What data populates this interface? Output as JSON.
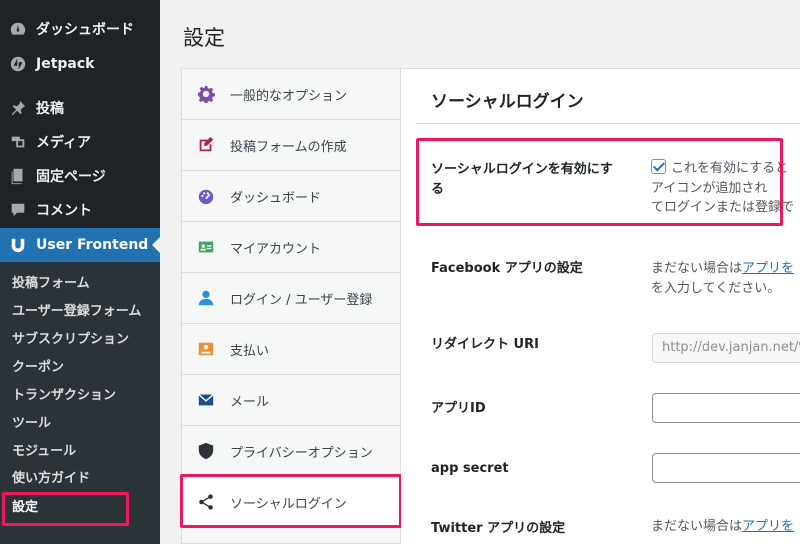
{
  "admin_menu": {
    "items": [
      {
        "label": "ダッシュボード",
        "icon": "dashboard-icon"
      },
      {
        "label": "Jetpack",
        "icon": "jetpack-icon"
      },
      {
        "label": "投稿",
        "icon": "pin-icon"
      },
      {
        "label": "メディア",
        "icon": "media-icon"
      },
      {
        "label": "固定ページ",
        "icon": "page-icon"
      },
      {
        "label": "コメント",
        "icon": "comment-icon"
      },
      {
        "label": "User Frontend",
        "icon": "user-frontend-icon"
      }
    ],
    "submenu": [
      "投稿フォーム",
      "ユーザー登録フォーム",
      "サブスクリプション",
      "クーポン",
      "トランザクション",
      "ツール",
      "モジュール",
      "使い方ガイド",
      "設定"
    ]
  },
  "page": {
    "title": "設定"
  },
  "settings_nav": [
    {
      "label": "一般的なオプション",
      "icon": "gear-icon"
    },
    {
      "label": "投稿フォームの作成",
      "icon": "edit-icon"
    },
    {
      "label": "ダッシュボード",
      "icon": "dashboard-gauge-icon"
    },
    {
      "label": "マイアカウント",
      "icon": "id-card-icon"
    },
    {
      "label": "ログイン / ユーザー登録",
      "icon": "user-icon"
    },
    {
      "label": "支払い",
      "icon": "payment-icon"
    },
    {
      "label": "メール",
      "icon": "mail-icon"
    },
    {
      "label": "プライバシーオプション",
      "icon": "shield-icon"
    },
    {
      "label": "ソーシャルログイン",
      "icon": "share-icon"
    }
  ],
  "section": {
    "title": "ソーシャルログイン",
    "enable_label": "ソーシャルログインを有効にする",
    "enable_desc_1": "これを有効にすると",
    "enable_desc_2": "アイコンが追加され",
    "enable_desc_3": "てログインまたは登録で",
    "facebook_label": "Facebook アプリの設定",
    "facebook_desc_1": "まだない場合は",
    "facebook_desc_link": "アプリを",
    "facebook_desc_2": "を入力してください。",
    "redirect_label": "リダイレクト URI",
    "redirect_value": "http://dev.janjan.net/%",
    "app_id_label": "アプリID",
    "app_id_value": "",
    "app_secret_label": "app secret",
    "app_secret_value": "",
    "twitter_label": "Twitter アプリの設定",
    "twitter_desc_1": "まだない場合は",
    "twitter_desc_link": "アプリを"
  },
  "colors": {
    "accent": "#2271b1",
    "highlight": "#e9195c",
    "sidebar": "#1d2327"
  }
}
